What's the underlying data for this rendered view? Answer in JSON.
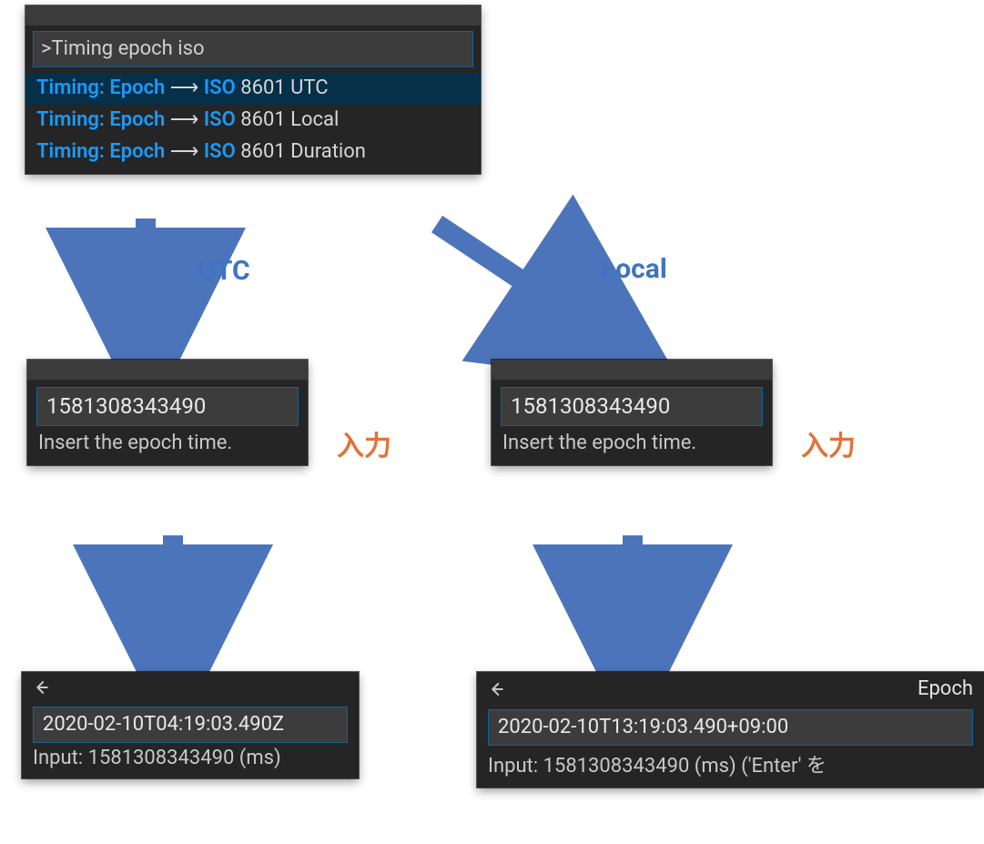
{
  "palette": {
    "query": ">Timing epoch iso",
    "items": [
      {
        "prefix": "Timing:",
        "word1": "Epoch",
        "arrow": "⟶",
        "word2": "ISO",
        "rest": "8601 UTC"
      },
      {
        "prefix": "Timing:",
        "word1": "Epoch",
        "arrow": "⟶",
        "word2": "ISO",
        "rest": "8601 Local"
      },
      {
        "prefix": "Timing:",
        "word1": "Epoch",
        "arrow": "⟶",
        "word2": "ISO",
        "rest": "8601 Duration"
      }
    ]
  },
  "labels": {
    "utc": "UTC",
    "local": "Local",
    "input_jp": "入力"
  },
  "epoch_input": {
    "value": "1581308343490",
    "hint": "Insert the epoch time."
  },
  "result_utc": {
    "title": "",
    "value": "2020-02-10T04:19:03.490Z",
    "sub": "Input: 1581308343490 (ms)"
  },
  "result_local": {
    "title": "Epoch",
    "value": "2020-02-10T13:19:03.490+09:00",
    "sub": "Input: 1581308343490 (ms) ('Enter' を"
  }
}
